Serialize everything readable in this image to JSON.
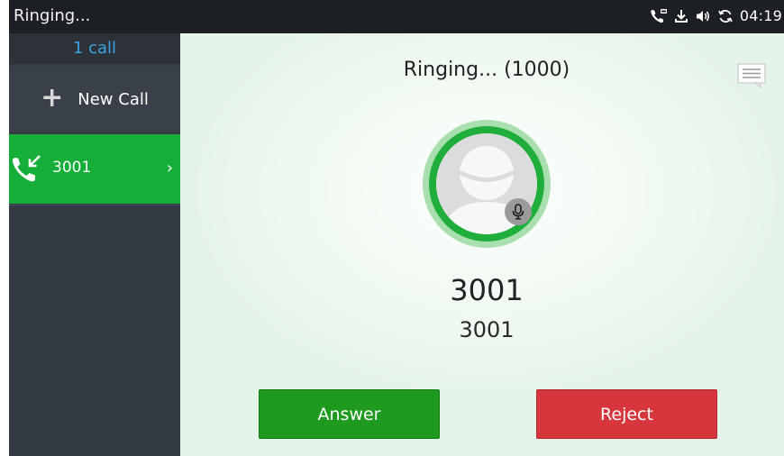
{
  "statusbar": {
    "title": "Ringing...",
    "time": "04:19",
    "icons": [
      "call-voicemail-icon",
      "download-icon",
      "volume-icon",
      "sync-icon"
    ]
  },
  "sidebar": {
    "call_count": "1 call",
    "new_call_label": "New Call",
    "calls": [
      {
        "number": "3001",
        "icon": "incoming-call-icon",
        "active": true
      }
    ]
  },
  "main": {
    "status_title": "Ringing... (1000)",
    "contact_name": "3001",
    "contact_number": "3001",
    "answer_label": "Answer",
    "reject_label": "Reject"
  },
  "colors": {
    "accent_green": "#14ae38",
    "answer": "#1e9a1e",
    "reject": "#d6363c",
    "count_blue": "#3aa3df",
    "sidebar_bg": "#343a43"
  }
}
